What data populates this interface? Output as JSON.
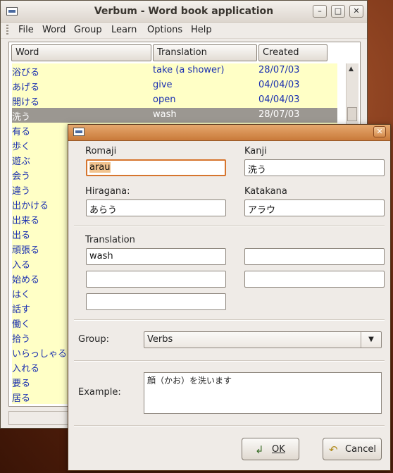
{
  "window": {
    "title": "Verbum - Word book application"
  },
  "menu": {
    "file": "File",
    "word": "Word",
    "group": "Group",
    "learn": "Learn",
    "options": "Options",
    "help": "Help"
  },
  "columns": {
    "word": "Word",
    "translation": "Translation",
    "created": "Created"
  },
  "rows": [
    {
      "word": "浴びる",
      "translation": "take (a shower)",
      "created": "28/07/03"
    },
    {
      "word": "あげる",
      "translation": "give",
      "created": "04/04/03"
    },
    {
      "word": "開ける",
      "translation": "open",
      "created": "04/04/03"
    },
    {
      "word": "洗う",
      "translation": "wash",
      "created": "28/07/03",
      "selected": true
    },
    {
      "word": "有る"
    },
    {
      "word": "歩く"
    },
    {
      "word": "遊ぶ"
    },
    {
      "word": "会う"
    },
    {
      "word": "違う"
    },
    {
      "word": "出かける"
    },
    {
      "word": "出来る"
    },
    {
      "word": "出る"
    },
    {
      "word": "頑張る"
    },
    {
      "word": "入る"
    },
    {
      "word": "始める"
    },
    {
      "word": "はく"
    },
    {
      "word": "話す"
    },
    {
      "word": "働く"
    },
    {
      "word": "拾う"
    },
    {
      "word": "いらっしゃる"
    },
    {
      "word": "入れる"
    },
    {
      "word": "要る"
    },
    {
      "word": "居る"
    }
  ],
  "dialog": {
    "romaji_label": "Romaji",
    "romaji_value": "arau",
    "kanji_label": "Kanji",
    "kanji_value": "洗う",
    "hiragana_label": "Hiragana:",
    "hiragana_value": "あらう",
    "katakana_label": "Katakana",
    "katakana_value": "アラウ",
    "translation_label": "Translation",
    "translations": [
      "wash",
      "",
      "",
      "",
      ""
    ],
    "group_label": "Group:",
    "group_value": "Verbs",
    "example_label": "Example:",
    "example_value": "顔（かお）を洗います",
    "ok_label": "OK",
    "cancel_label": "Cancel"
  },
  "colors": {
    "list_bg": "#ffffc6",
    "text_blue": "#1a2fb0",
    "selection": "#9b9791",
    "focus": "#d6752e"
  }
}
